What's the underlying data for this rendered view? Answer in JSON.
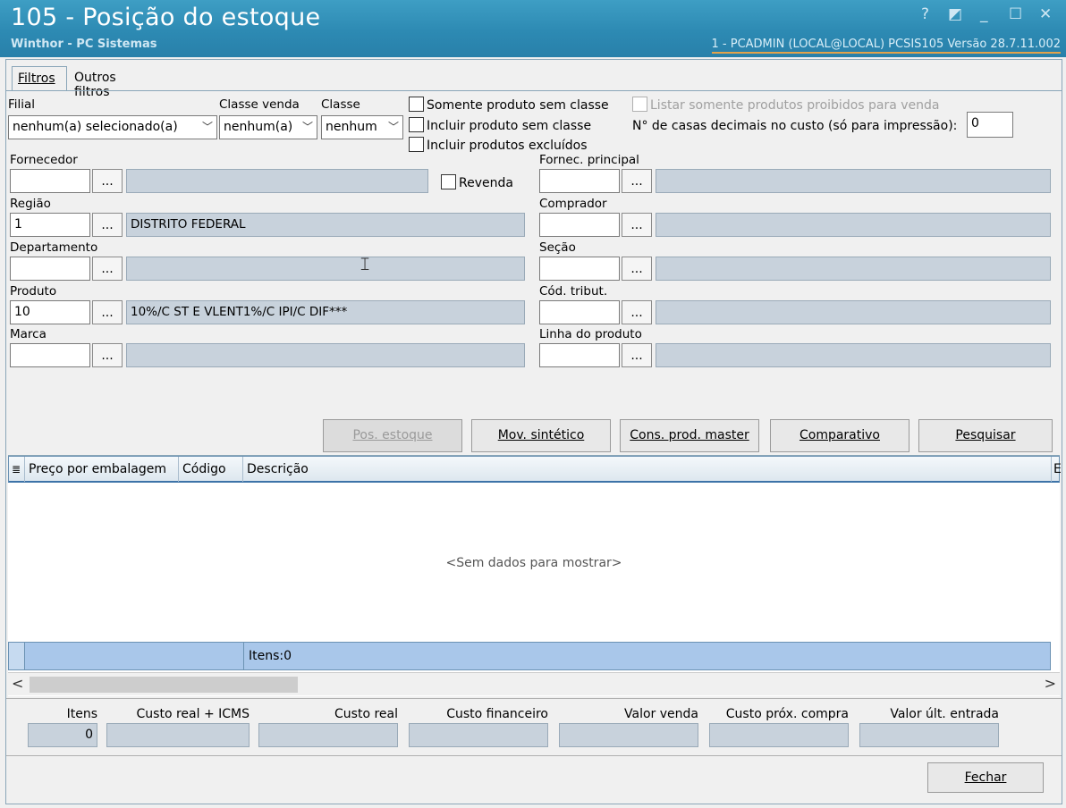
{
  "window": {
    "title": "105 - Posição do estoque",
    "subtitle": "Winthor - PC Sistemas",
    "session_info": "1 - PCADMIN (LOCAL@LOCAL)   PCSIS105  Versão  28.7.11.002",
    "controls": {
      "help": "?",
      "restore": "◩",
      "minimize": "_",
      "maximize": "☐",
      "close": "✕"
    }
  },
  "tabs": {
    "filtros": "Filtros",
    "outros_filtros": "Outros filtros"
  },
  "filters": {
    "filial_label": "Filial",
    "filial_value": "nenhum(a) selecionado(a)",
    "classe_venda_label": "Classe venda",
    "classe_venda_value": "nenhum(a)",
    "classe_label": "Classe",
    "classe_value": "nenhum",
    "somente_sem_classe": "Somente produto sem classe",
    "incluir_sem_classe": "Incluir produto sem classe",
    "incluir_excluidos": "Incluir produtos excluídos",
    "listar_proibidos": "Listar somente produtos proibidos para venda",
    "casas_decimais_label": "N° de casas decimais no custo (só para impressão):",
    "casas_decimais_value": "0",
    "fornecedor_label": "Fornecedor",
    "fornecedor_code": "",
    "fornecedor_desc": "",
    "revenda_label": "Revenda",
    "regiao_label": "Região",
    "regiao_code": "1",
    "regiao_desc": "DISTRITO FEDERAL",
    "departamento_label": "Departamento",
    "departamento_code": "",
    "departamento_desc": "",
    "produto_label": "Produto",
    "produto_code": "10",
    "produto_desc": "10%/C ST E VLENT1%/C IPI/C DIF***",
    "marca_label": "Marca",
    "marca_code": "",
    "marca_desc": "",
    "fornec_principal_label": "Fornec. principal",
    "comprador_label": "Comprador",
    "secao_label": "Seção",
    "cod_tribut_label": "Cód. tribut.",
    "linha_produto_label": "Linha do produto",
    "lookup_button": "..."
  },
  "actions": {
    "pos_estoque": "Pos. estoque",
    "mov_sintetico": "Mov. sintético",
    "cons_prod_master": "Cons. prod. master",
    "comparativo": "Comparativo",
    "pesquisar": "Pesquisar"
  },
  "grid": {
    "columns": [
      "Preço por embalagem",
      "Código",
      "Descrição",
      "E"
    ],
    "empty_message": "<Sem dados para mostrar>",
    "footer_items": "Itens:0",
    "scroll_left": "<",
    "scroll_right": ">",
    "column_chooser_icon": "≣"
  },
  "totals": {
    "labels": [
      "Itens",
      "Custo real + ICMS",
      "Custo real",
      "Custo financeiro",
      "Valor venda",
      "Custo próx. compra",
      "Valor últ. entrada"
    ],
    "values": [
      "0",
      "",
      "",
      "",
      "",
      "",
      ""
    ]
  },
  "footer": {
    "fechar": "Fechar"
  }
}
